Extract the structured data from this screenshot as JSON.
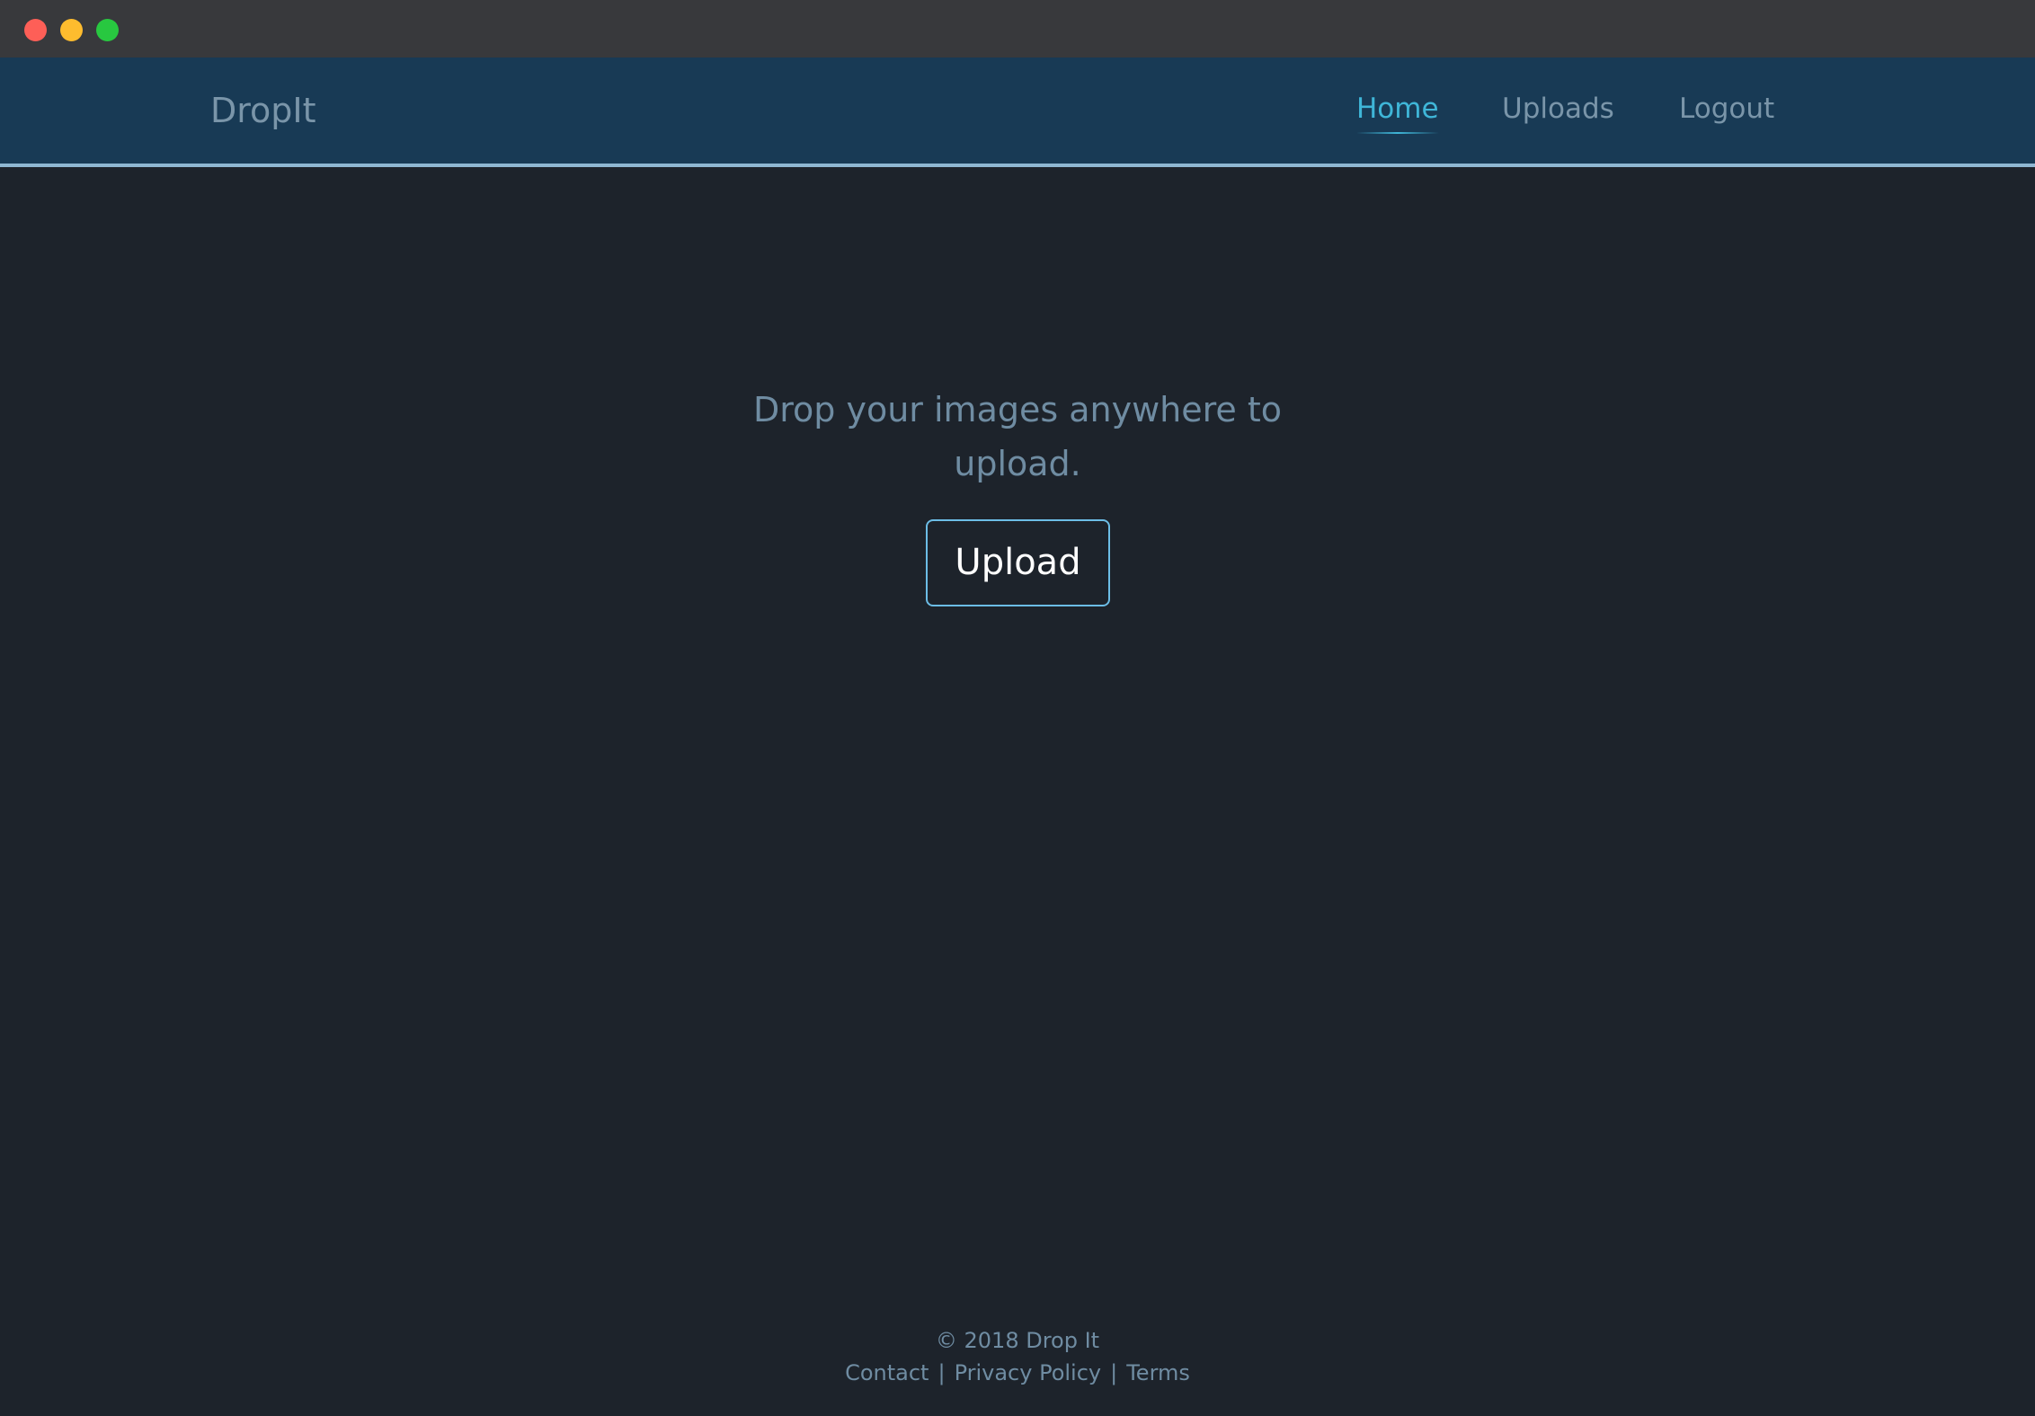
{
  "window": {
    "controls": [
      "close",
      "minimize",
      "maximize"
    ]
  },
  "navbar": {
    "brand": "DropIt",
    "links": [
      {
        "label": "Home",
        "active": true
      },
      {
        "label": "Uploads",
        "active": false
      },
      {
        "label": "Logout",
        "active": false
      }
    ]
  },
  "main": {
    "prompt_line1": "Drop your images anywhere to",
    "prompt_line2": "upload.",
    "upload_button": "Upload"
  },
  "footer": {
    "copyright": "© 2018 Drop It",
    "links": [
      "Contact",
      "Privacy Policy",
      "Terms"
    ],
    "separator": "|"
  },
  "colors": {
    "accent": "#3fb6d8",
    "navbar_bg": "#183a55",
    "page_bg": "#1d232b",
    "button_border": "#6cbde6"
  }
}
